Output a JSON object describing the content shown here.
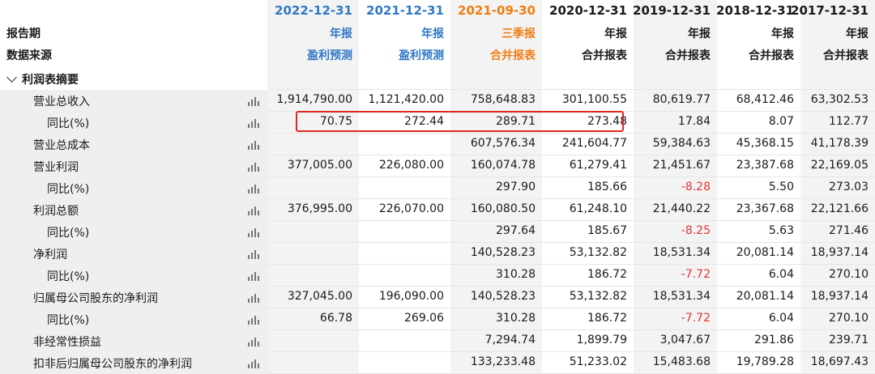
{
  "header": {
    "labels": [
      "报告期",
      "数据来源"
    ],
    "columns": [
      {
        "date": "2022-12-31",
        "type": "年报",
        "source": "盈利预测",
        "color": "blue"
      },
      {
        "date": "2021-12-31",
        "type": "年报",
        "source": "盈利预测",
        "color": "blue"
      },
      {
        "date": "2021-09-30",
        "type": "三季报",
        "source": "合并报表",
        "color": "orange"
      },
      {
        "date": "2020-12-31",
        "type": "年报",
        "source": "合并报表",
        "color": "black"
      },
      {
        "date": "2019-12-31",
        "type": "年报",
        "source": "合并报表",
        "color": "black"
      },
      {
        "date": "2018-12-31",
        "type": "年报",
        "source": "合并报表",
        "color": "black"
      },
      {
        "date": "2017-12-31",
        "type": "年报",
        "source": "合并报表",
        "color": "black"
      }
    ]
  },
  "section": {
    "label": "利润表摘要"
  },
  "rows": [
    {
      "label": "营业总收入",
      "sub": false,
      "values": [
        "1,914,790.00",
        "1,121,420.00",
        "758,648.83",
        "301,100.55",
        "80,619.77",
        "68,412.46",
        "63,302.53"
      ]
    },
    {
      "label": "同比(%)",
      "sub": true,
      "values": [
        "70.75",
        "272.44",
        "289.71",
        "273.48",
        "17.84",
        "8.07",
        "112.77"
      ]
    },
    {
      "label": "营业总成本",
      "sub": false,
      "values": [
        "",
        "",
        "607,576.34",
        "241,604.77",
        "59,384.63",
        "45,368.15",
        "41,178.39"
      ]
    },
    {
      "label": "营业利润",
      "sub": false,
      "values": [
        "377,005.00",
        "226,080.00",
        "160,074.78",
        "61,279.41",
        "21,451.67",
        "23,387.68",
        "22,169.05"
      ]
    },
    {
      "label": "同比(%)",
      "sub": true,
      "values": [
        "",
        "",
        "297.90",
        "185.66",
        "-8.28",
        "5.50",
        "273.03"
      ]
    },
    {
      "label": "利润总额",
      "sub": false,
      "values": [
        "376,995.00",
        "226,070.00",
        "160,080.50",
        "61,248.10",
        "21,440.22",
        "23,367.68",
        "22,121.66"
      ]
    },
    {
      "label": "同比(%)",
      "sub": true,
      "values": [
        "",
        "",
        "297.64",
        "185.67",
        "-8.25",
        "5.63",
        "271.46"
      ]
    },
    {
      "label": "净利润",
      "sub": false,
      "values": [
        "",
        "",
        "140,528.23",
        "53,132.82",
        "18,531.34",
        "20,081.14",
        "18,937.14"
      ]
    },
    {
      "label": "同比(%)",
      "sub": true,
      "values": [
        "",
        "",
        "310.28",
        "186.72",
        "-7.72",
        "6.04",
        "270.10"
      ]
    },
    {
      "label": "归属母公司股东的净利润",
      "sub": false,
      "values": [
        "327,045.00",
        "196,090.00",
        "140,528.23",
        "53,132.82",
        "18,531.34",
        "20,081.14",
        "18,937.14"
      ]
    },
    {
      "label": "同比(%)",
      "sub": true,
      "values": [
        "66.78",
        "269.06",
        "310.28",
        "186.72",
        "-7.72",
        "6.04",
        "270.10"
      ]
    },
    {
      "label": "非经常性损益",
      "sub": false,
      "values": [
        "",
        "",
        "7,294.74",
        "1,899.79",
        "3,047.67",
        "291.86",
        "239.71"
      ]
    },
    {
      "label": "扣非后归属母公司股东的净利润",
      "sub": false,
      "values": [
        "",
        "",
        "133,233.48",
        "51,233.02",
        "15,483.68",
        "19,789.28",
        "18,697.43"
      ]
    }
  ],
  "colors": {
    "blue": "#2f78c4",
    "orange": "#ef7d12",
    "negative": "#e33535",
    "highlight_box": "#e0271f"
  },
  "icons": {
    "row_chart": "bar-chart-icon",
    "section_toggle": "chevron-down-icon"
  }
}
